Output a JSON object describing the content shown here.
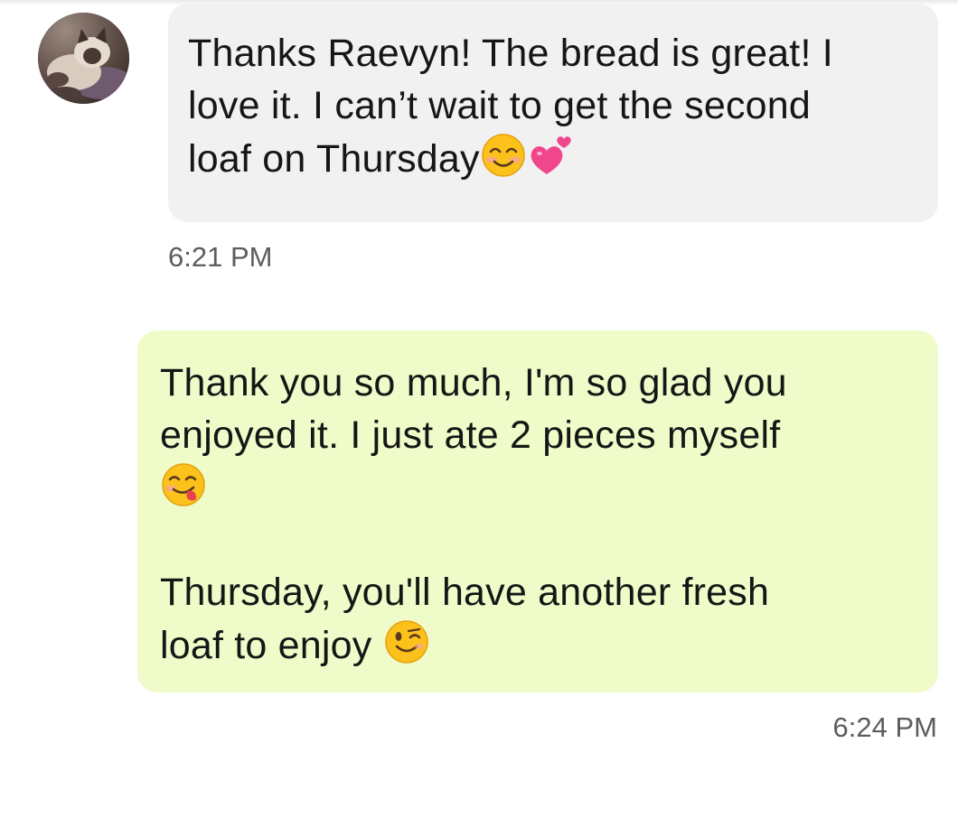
{
  "incoming": {
    "lines": [
      "Thanks Raevyn! The bread is great! I",
      "love it. I can’t wait to get the second",
      "loaf on Thursday"
    ],
    "emojis": [
      "smiling-face-icon",
      "two-hearts-icon"
    ],
    "time": "6:21 PM"
  },
  "outgoing": {
    "lines": [
      "Thank you so much, I'm so glad you",
      "enjoyed it. I just ate 2 pieces myself",
      "Thursday, you'll have another fresh",
      "loaf to enjoy "
    ],
    "emojis": [
      "yummy-face-icon",
      "winking-face-icon"
    ],
    "time": "6:24 PM"
  },
  "colors": {
    "incoming_bubble": "#f1f1f1",
    "outgoing_bubble": "#effcc9",
    "text": "#161616",
    "timestamp": "#5d5d5d"
  }
}
